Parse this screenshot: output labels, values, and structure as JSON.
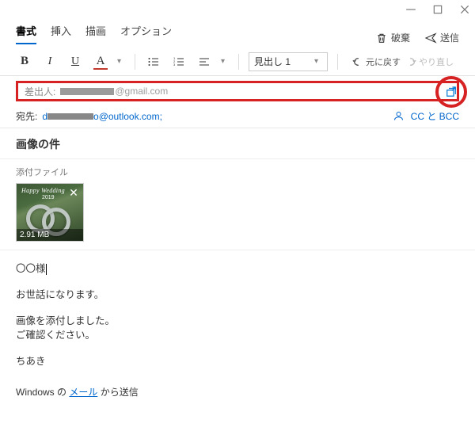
{
  "tabs": {
    "format": "書式",
    "insert": "挿入",
    "draw": "描画",
    "options": "オプション"
  },
  "actions": {
    "discard": "破棄",
    "send": "送信"
  },
  "toolbar": {
    "bold": "B",
    "italic": "I",
    "underline": "U",
    "fontcolor": "A",
    "heading_select": "見出し 1",
    "undo": "元に戻す",
    "redo": "やり直し"
  },
  "from": {
    "label": "差出人:",
    "domain": "@gmail.com"
  },
  "to": {
    "label": "宛先:",
    "prefix": "d",
    "suffix": "o@outlook.com;",
    "ccbcc": "CC と BCC"
  },
  "subject": "画像の件",
  "attachment": {
    "section_label": "添付ファイル",
    "tag": "Happy Wedding",
    "year": "2019",
    "size": "2.91 MB"
  },
  "body": {
    "greeting": "〇〇様",
    "l1": "お世話になります。",
    "l2": "画像を添付しました。",
    "l3": "ご確認ください。",
    "name": "ちあき"
  },
  "signature": {
    "prefix": "Windows の ",
    "link": "メール",
    "suffix": " から送信"
  }
}
